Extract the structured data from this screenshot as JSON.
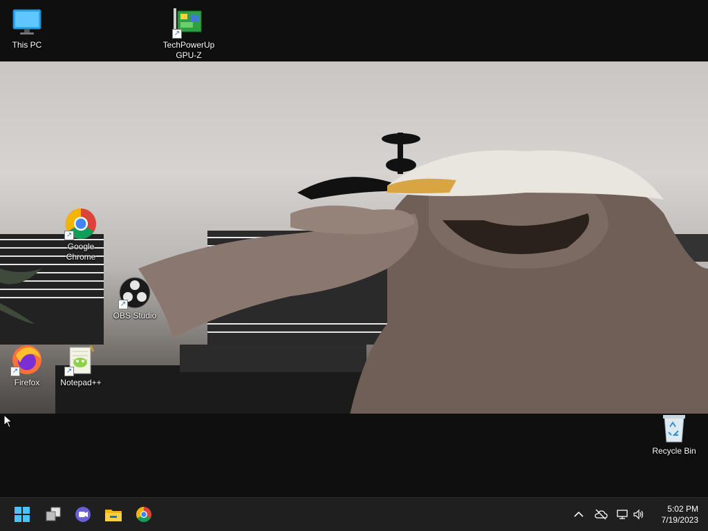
{
  "desktop": {
    "icons": [
      {
        "label": "This PC"
      },
      {
        "label": "TechPowerUp\nGPU-Z"
      },
      {
        "label": "Google\nChrome"
      },
      {
        "label": "OBS Studio"
      },
      {
        "label": "Firefox"
      },
      {
        "label": "Notepad++"
      },
      {
        "label": "Recycle Bin"
      }
    ]
  },
  "taskbar": {
    "pinned": [
      "start-icon",
      "task-view-icon",
      "chat-icon",
      "file-explorer-icon",
      "chrome-icon"
    ],
    "tray": [
      "chevron-up-icon",
      "cloud-off-icon",
      "network-icon",
      "volume-icon"
    ],
    "clock": {
      "time": "5:02 PM",
      "date": "7/19/2023"
    }
  },
  "colors": {
    "taskbar": "#1f1f1f",
    "accent": "#4cc2ff"
  }
}
